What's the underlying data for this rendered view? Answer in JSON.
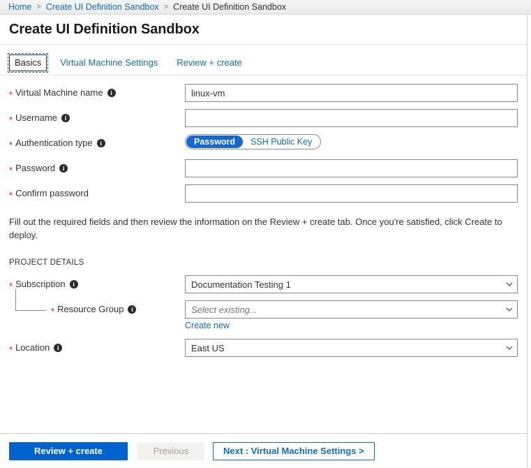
{
  "breadcrumb": {
    "items": [
      {
        "label": "Home",
        "link": true
      },
      {
        "label": "Create UI Definition Sandbox",
        "link": true
      },
      {
        "label": "Create UI Definition Sandbox",
        "link": false
      }
    ],
    "separator": ">"
  },
  "header": {
    "title": "Create UI Definition Sandbox"
  },
  "tabs": [
    {
      "label": "Basics",
      "active": true
    },
    {
      "label": "Virtual Machine Settings",
      "active": false
    },
    {
      "label": "Review + create",
      "active": false
    }
  ],
  "form": {
    "vm_name": {
      "label": "Virtual Machine name",
      "required_marker": "*",
      "info_glyph": "i",
      "value": "linux-vm",
      "placeholder": ""
    },
    "username": {
      "label": "Username",
      "required_marker": "*",
      "info_glyph": "i",
      "value": "",
      "placeholder": ""
    },
    "auth_type": {
      "label": "Authentication type",
      "required_marker": "*",
      "info_glyph": "i",
      "options": [
        "Password",
        "SSH Public Key"
      ],
      "selected": "Password"
    },
    "password": {
      "label": "Password",
      "required_marker": "*",
      "info_glyph": "i",
      "value": "",
      "placeholder": ""
    },
    "confirm_password": {
      "label": "Confirm password",
      "required_marker": "*",
      "value": "",
      "placeholder": ""
    }
  },
  "description": "Fill out the required fields and then review the information on the Review + create tab. Once you're satisfied, click Create to deploy.",
  "project_details": {
    "section_label": "PROJECT DETAILS",
    "subscription": {
      "label": "Subscription",
      "required_marker": "*",
      "info_glyph": "i",
      "value": "Documentation Testing 1"
    },
    "resource_group": {
      "label": "Resource Group",
      "required_marker": "*",
      "info_glyph": "i",
      "value": "",
      "placeholder": "Select existing...",
      "create_new_label": "Create new"
    },
    "location": {
      "label": "Location",
      "required_marker": "*",
      "info_glyph": "i",
      "value": "East US"
    }
  },
  "footer": {
    "review_create_label": "Review + create",
    "previous_label": "Previous",
    "next_label": "Next : Virtual Machine Settings >"
  },
  "colors": {
    "accent_blue": "#0f6cbd",
    "primary_button": "#0062cf",
    "toggle_selected": "#1367d2",
    "required_red": "#e81123",
    "text": "#323130",
    "border": "#8a8886"
  }
}
